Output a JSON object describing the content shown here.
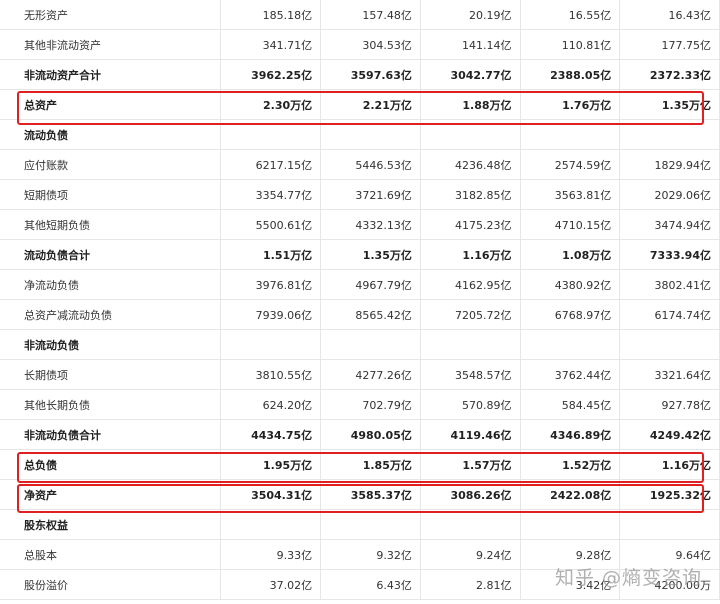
{
  "table": {
    "rows": [
      {
        "label": "无形资产",
        "values": [
          "185.18亿",
          "157.48亿",
          "20.19亿",
          "16.55亿",
          "16.43亿"
        ],
        "bold": false
      },
      {
        "label": "其他非流动资产",
        "values": [
          "341.71亿",
          "304.53亿",
          "141.14亿",
          "110.81亿",
          "177.75亿"
        ],
        "bold": false
      },
      {
        "label": "非流动资产合计",
        "values": [
          "3962.25亿",
          "3597.63亿",
          "3042.77亿",
          "2388.05亿",
          "2372.33亿"
        ],
        "bold": true
      },
      {
        "label": "总资产",
        "values": [
          "2.30万亿",
          "2.21万亿",
          "1.88万亿",
          "1.76万亿",
          "1.35万亿"
        ],
        "bold": true
      },
      {
        "label": "流动负债",
        "values": [
          "",
          "",
          "",
          "",
          ""
        ],
        "bold": true
      },
      {
        "label": "应付账款",
        "values": [
          "6217.15亿",
          "5446.53亿",
          "4236.48亿",
          "2574.59亿",
          "1829.94亿"
        ],
        "bold": false
      },
      {
        "label": "短期债项",
        "values": [
          "3354.77亿",
          "3721.69亿",
          "3182.85亿",
          "3563.81亿",
          "2029.06亿"
        ],
        "bold": false
      },
      {
        "label": "其他短期负债",
        "values": [
          "5500.61亿",
          "4332.13亿",
          "4175.23亿",
          "4710.15亿",
          "3474.94亿"
        ],
        "bold": false
      },
      {
        "label": "流动负债合计",
        "values": [
          "1.51万亿",
          "1.35万亿",
          "1.16万亿",
          "1.08万亿",
          "7333.94亿"
        ],
        "bold": true
      },
      {
        "label": "净流动负债",
        "values": [
          "3976.81亿",
          "4967.79亿",
          "4162.95亿",
          "4380.92亿",
          "3802.41亿"
        ],
        "bold": false
      },
      {
        "label": "总资产减流动负债",
        "values": [
          "7939.06亿",
          "8565.42亿",
          "7205.72亿",
          "6768.97亿",
          "6174.74亿"
        ],
        "bold": false
      },
      {
        "label": "非流动负债",
        "values": [
          "",
          "",
          "",
          "",
          ""
        ],
        "bold": true
      },
      {
        "label": "长期债项",
        "values": [
          "3810.55亿",
          "4277.26亿",
          "3548.57亿",
          "3762.44亿",
          "3321.64亿"
        ],
        "bold": false
      },
      {
        "label": "其他长期负债",
        "values": [
          "624.20亿",
          "702.79亿",
          "570.89亿",
          "584.45亿",
          "927.78亿"
        ],
        "bold": false
      },
      {
        "label": "非流动负债合计",
        "values": [
          "4434.75亿",
          "4980.05亿",
          "4119.46亿",
          "4346.89亿",
          "4249.42亿"
        ],
        "bold": true
      },
      {
        "label": "总负债",
        "values": [
          "1.95万亿",
          "1.85万亿",
          "1.57万亿",
          "1.52万亿",
          "1.16万亿"
        ],
        "bold": true
      },
      {
        "label": "净资产",
        "values": [
          "3504.31亿",
          "3585.37亿",
          "3086.26亿",
          "2422.08亿",
          "1925.32亿"
        ],
        "bold": true
      },
      {
        "label": "股东权益",
        "values": [
          "",
          "",
          "",
          "",
          ""
        ],
        "bold": true
      },
      {
        "label": "总股本",
        "values": [
          "9.33亿",
          "9.32亿",
          "9.24亿",
          "9.28亿",
          "9.64亿"
        ],
        "bold": false
      },
      {
        "label": "股份溢价",
        "values": [
          "37.02亿",
          "6.43亿",
          "2.81亿",
          "3.42亿",
          "4200.00万"
        ],
        "bold": false
      }
    ]
  },
  "highlight_color": "#e02020",
  "watermark": "知乎 @熵变咨询"
}
